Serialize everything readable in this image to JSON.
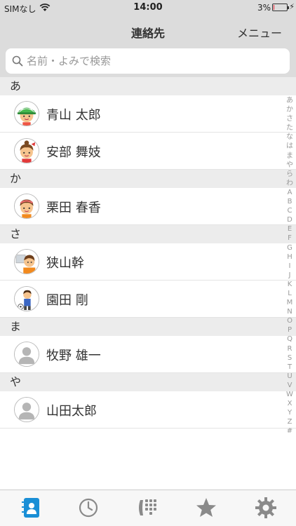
{
  "status": {
    "carrier": "SIMなし",
    "time": "14:00",
    "battery": "3%",
    "battery_level": 0.03
  },
  "nav": {
    "title": "連絡先",
    "menu_label": "メニュー"
  },
  "search": {
    "placeholder": "名前・よみで検索",
    "value": ""
  },
  "sections": [
    {
      "header": "あ",
      "contacts": [
        {
          "name": "青山 太郎",
          "avatar": "boy-green-cap-icon"
        },
        {
          "name": "安部 舞妓",
          "avatar": "girl-red-bow-icon"
        }
      ]
    },
    {
      "header": "か",
      "contacts": [
        {
          "name": "栗田 春香",
          "avatar": "girl-headband-icon"
        }
      ]
    },
    {
      "header": "さ",
      "contacts": [
        {
          "name": "狭山幹",
          "avatar": "person-with-photo-icon"
        },
        {
          "name": "園田 剛",
          "avatar": "boy-soccer-icon"
        }
      ]
    },
    {
      "header": "ま",
      "contacts": [
        {
          "name": "牧野 雄一",
          "avatar": "default-person-icon"
        }
      ]
    },
    {
      "header": "や",
      "contacts": [
        {
          "name": "山田太郎",
          "avatar": "default-person-icon"
        }
      ]
    }
  ],
  "index": [
    "あ",
    "か",
    "さ",
    "た",
    "な",
    "は",
    "ま",
    "や",
    "ら",
    "わ",
    "A",
    "B",
    "C",
    "D",
    "E",
    "F",
    "G",
    "H",
    "I",
    "J",
    "K",
    "L",
    "M",
    "N",
    "O",
    "P",
    "Q",
    "R",
    "S",
    "T",
    "U",
    "V",
    "W",
    "X",
    "Y",
    "Z",
    "#"
  ],
  "tabs": [
    {
      "name": "contacts-tab",
      "icon": "address-book-icon",
      "active": true
    },
    {
      "name": "history-tab",
      "icon": "clock-icon",
      "active": false
    },
    {
      "name": "keypad-tab",
      "icon": "phone-keypad-icon",
      "active": false
    },
    {
      "name": "favorites-tab",
      "icon": "star-icon",
      "active": false
    },
    {
      "name": "settings-tab",
      "icon": "gear-icon",
      "active": false
    }
  ],
  "colors": {
    "accent": "#1a8fd6",
    "inactive_icon": "#8a8a8a",
    "header_bg": "#dcdcdc",
    "section_bg": "#ececec"
  }
}
